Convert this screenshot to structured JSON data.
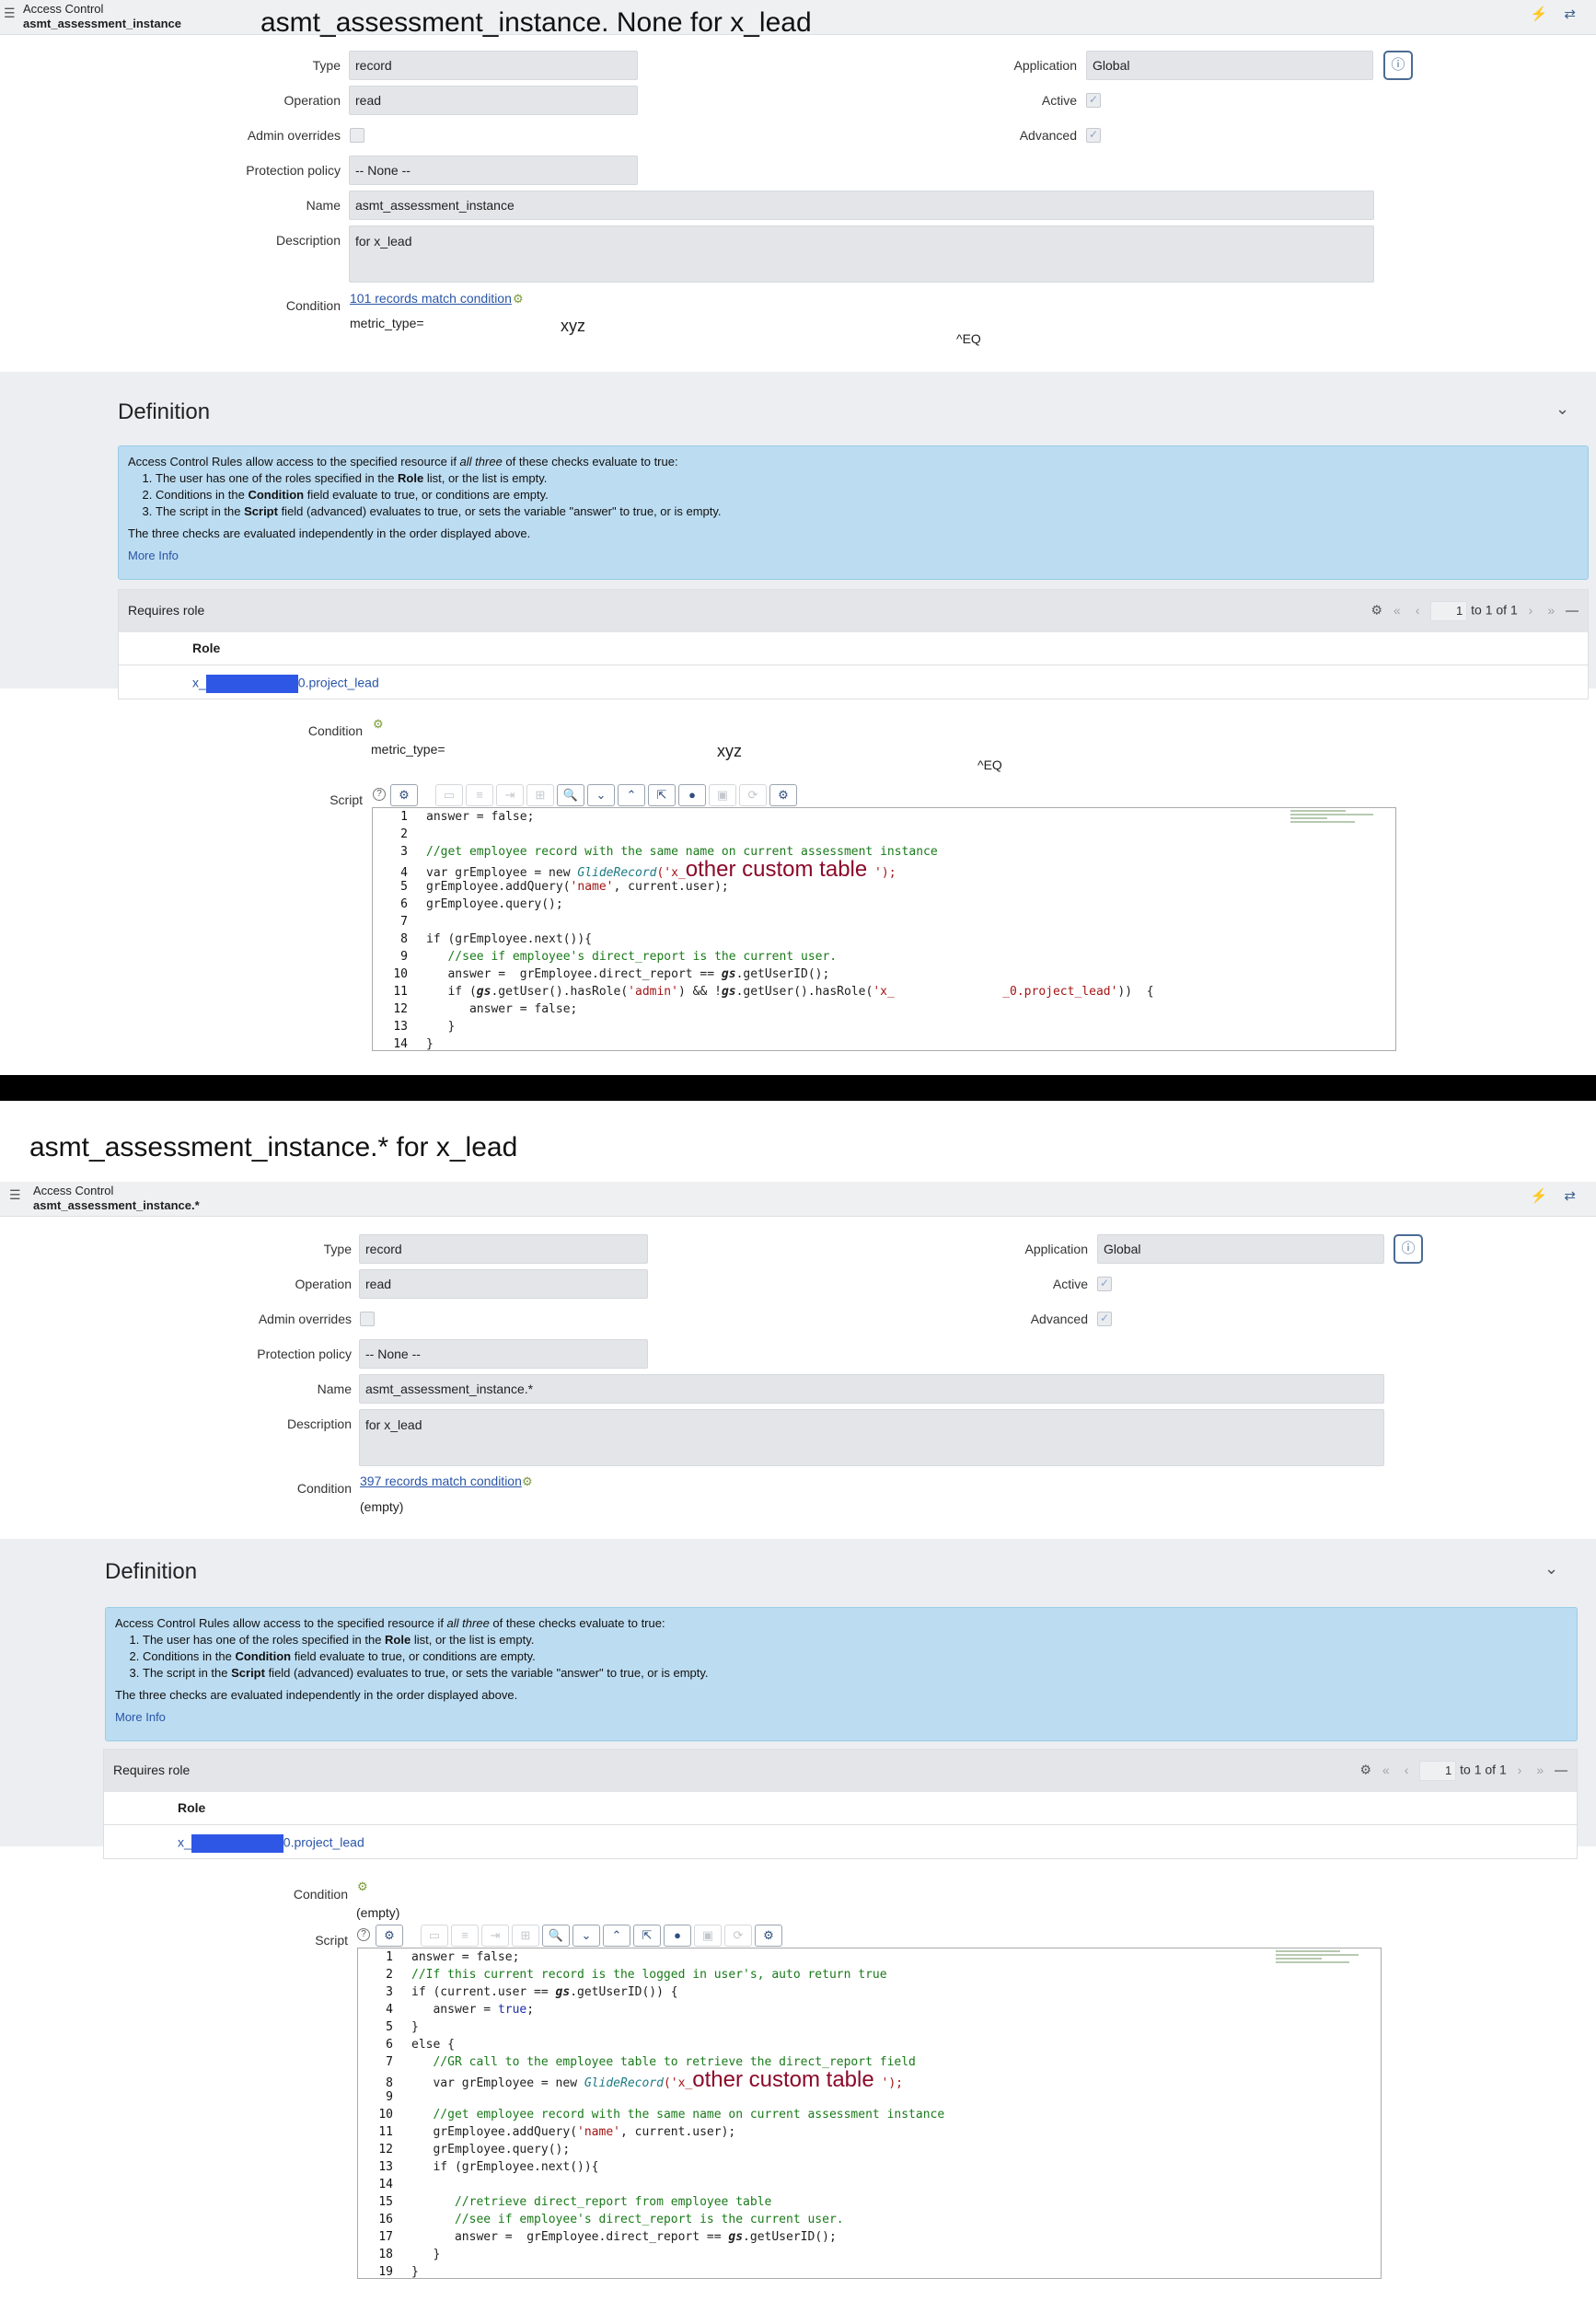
{
  "top": {
    "header": {
      "line1": "Access Control",
      "line2": "asmt_assessment_instance",
      "overlay_title": "asmt_assessment_instance. None  for x_lead"
    },
    "form": {
      "type_label": "Type",
      "type_value": "record",
      "operation_label": "Operation",
      "operation_value": "read",
      "admin_label": "Admin overrides",
      "protection_label": "Protection policy",
      "protection_value": "-- None --",
      "name_label": "Name",
      "name_value": "asmt_assessment_instance",
      "description_label": "Description",
      "description_value": "for x_lead",
      "condition_label": "Condition",
      "condition_link": "101 records match condition",
      "condition_text": "metric_type=",
      "condition_overlay": "xyz",
      "condition_eq": "^EQ",
      "application_label": "Application",
      "application_value": "Global",
      "active_label": "Active",
      "advanced_label": "Advanced"
    },
    "definition": {
      "title": "Definition",
      "intro_a": "Access Control Rules allow access to the specified resource if ",
      "intro_em": "all three",
      "intro_b": " of these checks evaluate to true:",
      "li1_a": "The user has one of the roles specified in the ",
      "li1_b": "Role",
      "li1_c": " list, or the list is empty.",
      "li2_a": "Conditions in the ",
      "li2_b": "Condition",
      "li2_c": " field evaluate to true, or conditions are empty.",
      "li3_a": "The script in the ",
      "li3_b": "Script",
      "li3_c": " field (advanced) evaluates to true, or sets the variable \"answer\" to true, or is empty.",
      "note": "The three checks are evaluated independently in the order displayed above.",
      "more_info": "More Info"
    },
    "roles": {
      "title": "Requires role",
      "page_value": "1",
      "page_of": "to 1 of 1",
      "col": "Role",
      "role_prefix": "x_",
      "role_suffix": "0.project_lead"
    },
    "condition2": {
      "label": "Condition",
      "text": "metric_type=",
      "overlay": "xyz",
      "eq": "^EQ"
    },
    "script": {
      "label": "Script",
      "lines": [
        "1",
        "2",
        "3",
        "4",
        "5",
        "6",
        "7",
        "8",
        "9",
        "10",
        "11",
        "12",
        "13",
        "14"
      ],
      "c1": "answer = false;",
      "c3": "//get employee record with the same name on current assessment instance",
      "c4a": "var grEmployee = new ",
      "c4b": "GlideRecord",
      "c4c": "('x_",
      "c4d": "other custom table",
      "c4e": " ');",
      "c5a": "grEmployee.addQuery(",
      "c5b": "'name'",
      "c5c": ", current.user);",
      "c6": "grEmployee.query();",
      "c8": "if (grEmployee.next()){",
      "c9": "//see if employee's direct_report is the current user.",
      "c10a": "answer =  grEmployee.direct_report == ",
      "c10b": "gs",
      "c10c": ".getUserID();",
      "c11a": "if (",
      "c11b": "gs",
      "c11c": ".getUser().hasRole(",
      "c11d": "'admin'",
      "c11e": ") && !",
      "c11f": "gs",
      "c11g": ".getUser().hasRole(",
      "c11h": "'x_               _0.project_lead'",
      "c11i": "))  {",
      "c12": "answer = false;",
      "c13": "}",
      "c14": "}"
    }
  },
  "bottom": {
    "screenshot_caption": "asmt_assessment_instance.* for x_lead",
    "header": {
      "line1": "Access Control",
      "line2": "asmt_assessment_instance.*"
    },
    "form": {
      "type_label": "Type",
      "type_value": "record",
      "operation_label": "Operation",
      "operation_value": "read",
      "admin_label": "Admin overrides",
      "protection_label": "Protection policy",
      "protection_value": "-- None --",
      "name_label": "Name",
      "name_value": "asmt_assessment_instance.*",
      "description_label": "Description",
      "description_value": "for x_lead",
      "condition_label": "Condition",
      "condition_link": "397 records match condition",
      "condition_text": "(empty)",
      "application_label": "Application",
      "application_value": "Global",
      "active_label": "Active",
      "advanced_label": "Advanced"
    },
    "definition": {
      "title": "Definition",
      "intro_a": "Access Control Rules allow access to the specified resource if ",
      "intro_em": "all three",
      "intro_b": " of these checks evaluate to true:",
      "li1_a": "The user has one of the roles specified in the ",
      "li1_b": "Role",
      "li1_c": " list, or the list is empty.",
      "li2_a": "Conditions in the ",
      "li2_b": "Condition",
      "li2_c": " field evaluate to true, or conditions are empty.",
      "li3_a": "The script in the ",
      "li3_b": "Script",
      "li3_c": " field (advanced) evaluates to true, or sets the variable \"answer\" to true, or is empty.",
      "note": "The three checks are evaluated independently in the order displayed above.",
      "more_info": "More Info"
    },
    "roles": {
      "title": "Requires role",
      "page_value": "1",
      "page_of": "to 1 of 1",
      "col": "Role",
      "role_prefix": "x_",
      "role_suffix": "0.project_lead"
    },
    "condition2": {
      "label": "Condition",
      "text": "(empty)"
    },
    "script": {
      "label": "Script",
      "c1": "answer = false;",
      "c2": "//If this current record is the logged in user's, auto return true",
      "c3a": "if (current.user == ",
      "c3b": "gs",
      "c3c": ".getUserID()) {",
      "c4a": "answer = ",
      "c4b": "true",
      "c4c": ";",
      "c5": "}",
      "c6": "else {",
      "c7": "//GR call to the employee table to retrieve the direct_report field",
      "c8a": "var grEmployee = new ",
      "c8b": "GlideRecord",
      "c8c": "('x_",
      "c8d": "other custom table",
      "c8e": " ');",
      "c10": "//get employee record with the same name on current assessment instance",
      "c11a": "grEmployee.addQuery(",
      "c11b": "'name'",
      "c11c": ", current.user);",
      "c12": "grEmployee.query();",
      "c13": "if (grEmployee.next()){",
      "c15": "//retrieve direct_report from employee table",
      "c16": "//see if employee's direct_report is the current user.",
      "c17a": "answer =  grEmployee.direct_report == ",
      "c17b": "gs",
      "c17c": ".getUserID();",
      "c18": "}",
      "c19": "}"
    }
  },
  "icons": {
    "menu": "hamburger-icon",
    "info": "info-icon",
    "settings": "gear-icon",
    "collapse": "chevron-down-icon",
    "help": "help-icon"
  }
}
